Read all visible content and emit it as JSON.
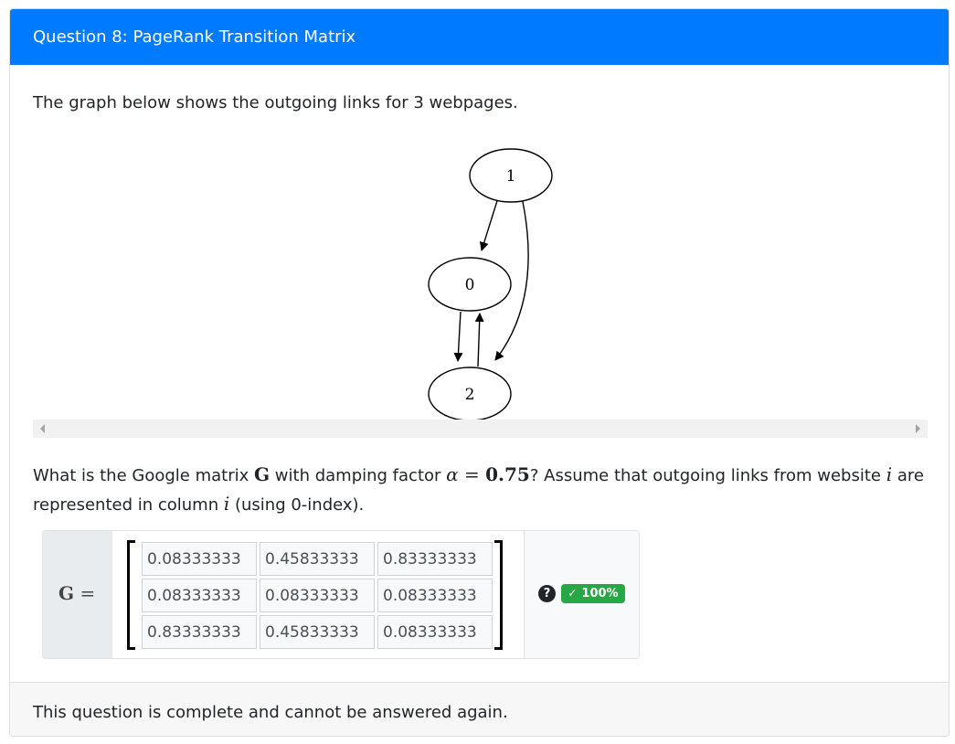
{
  "header": {
    "title": "Question 8: PageRank Transition Matrix"
  },
  "intro": "The graph below shows the outgoing links for 3 webpages.",
  "graph": {
    "nodes": [
      "1",
      "0",
      "2"
    ]
  },
  "question": {
    "part1": "What is the Google matrix ",
    "matrix_symbol": "G",
    "part2": " with damping factor ",
    "alpha_symbol": "α",
    "equals": " = ",
    "alpha_value": "0.75",
    "part3": "? Assume that outgoing links from website ",
    "i_symbol": "i",
    "part4": " are represented in column ",
    "part5": " (using 0-index)."
  },
  "answer": {
    "prefix_symbol": "G",
    "prefix_equals": " =",
    "matrix": [
      [
        "0.08333333",
        "0.45833333",
        "0.83333333"
      ],
      [
        "0.08333333",
        "0.08333333",
        "0.08333333"
      ],
      [
        "0.83333333",
        "0.45833333",
        "0.08333333"
      ]
    ],
    "help_icon": "?",
    "badge": "✓ 100%",
    "badge_color": "#28a745"
  },
  "footer": {
    "text": "This question is complete and cannot be answered again."
  },
  "colors": {
    "header_bg": "#007bff",
    "footer_bg": "#f7f7f7"
  }
}
